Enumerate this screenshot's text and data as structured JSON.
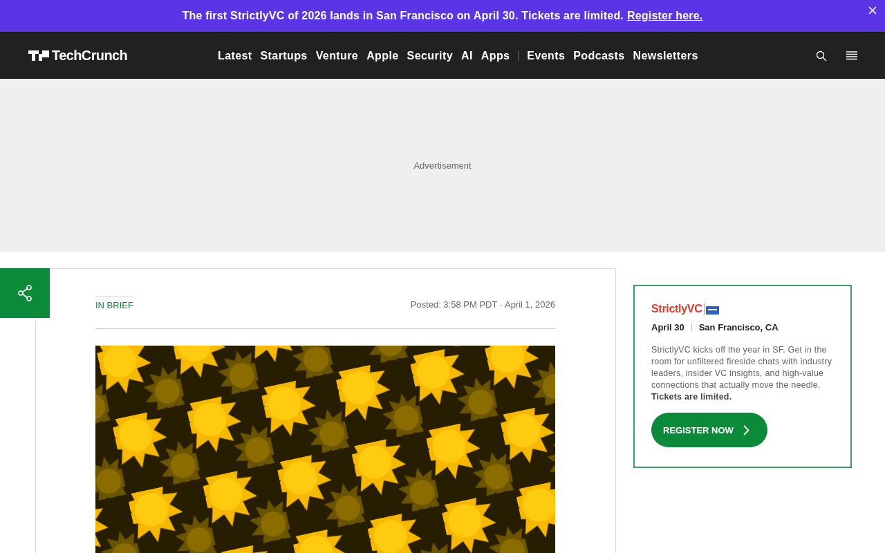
{
  "announcement": {
    "text": "The first StrictlyVC of 2026 lands in San Francisco on April 30. Tickets are limited.",
    "link": "Register here."
  },
  "header": {
    "logo": "TechCrunch",
    "nav_primary": [
      "Latest",
      "Startups",
      "Venture",
      "Apple",
      "Security",
      "AI",
      "Apps"
    ],
    "nav_secondary": [
      "Events",
      "Podcasts",
      "Newsletters"
    ]
  },
  "ad": {
    "label": "Advertisement"
  },
  "article": {
    "category": "IN BRIEF",
    "posted": "Posted: 3:58 PM PDT · April 1, 2026"
  },
  "event_card": {
    "logo": "StrictlyVC",
    "date": "April 30",
    "location": "San Francisco, CA",
    "description": "StrictlyVC kicks off the year in SF. Get in the room for unfiltered fireside chats with industry leaders, insider VC insights, and high-value connections that actually move the needle. **Tickets are limited.**",
    "button": "REGISTER NOW"
  }
}
